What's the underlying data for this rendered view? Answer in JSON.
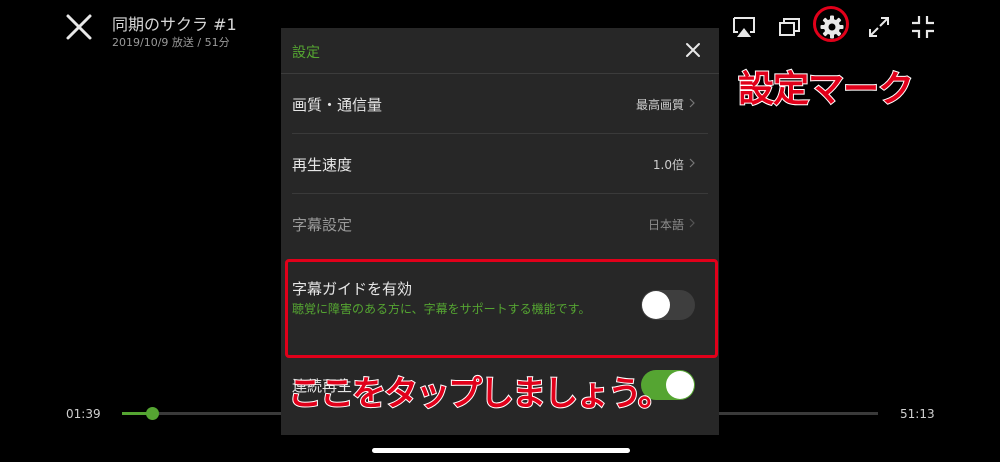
{
  "player": {
    "title": "同期のサクラ #1",
    "meta": "2019/10/9 放送 / 51分",
    "current_time": "01:39",
    "duration": "51:13",
    "progress": 0.04
  },
  "toolbar": {
    "icons": [
      "close-icon",
      "airplay-icon",
      "pip-icon",
      "gear-icon",
      "expand-icon",
      "shrink-icon"
    ]
  },
  "settings": {
    "title": "設定",
    "rows": [
      {
        "label": "画質・通信量",
        "value": "最高画質"
      },
      {
        "label": "再生速度",
        "value": "1.0倍"
      },
      {
        "label": "字幕設定",
        "value": "日本語"
      }
    ],
    "subtitle_guide": {
      "label": "字幕ガイドを有効",
      "description": "聴覚に障害のある方に、字幕をサポートする機能です。",
      "enabled": false
    },
    "continuous_play": {
      "label": "連続再生",
      "enabled": true
    }
  },
  "annotations": {
    "gear_label": "設定マーク",
    "tap_label": "ここをタップしましょう。",
    "color": "#e1001a"
  },
  "colors": {
    "accent": "#55a532",
    "panel": "#272727",
    "background": "#000000"
  }
}
